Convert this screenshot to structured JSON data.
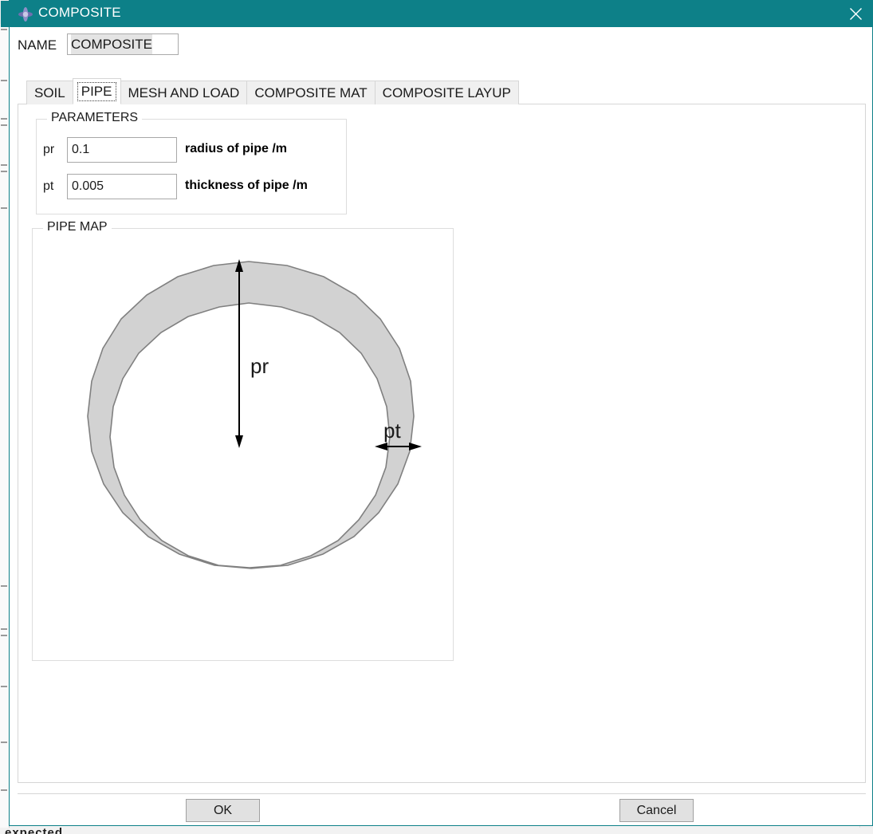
{
  "window": {
    "title": "COMPOSITE",
    "app_icon": "plus-crosshair-icon",
    "close_icon": "close-icon",
    "titlebar_color": "#0d8088"
  },
  "name_field": {
    "label": "NAME",
    "value": "COMPOSITE",
    "placeholder": "COMPOSITE"
  },
  "tabs": [
    {
      "label": "SOIL",
      "active": false
    },
    {
      "label": "PIPE",
      "active": true
    },
    {
      "label": "MESH AND LOAD",
      "active": false
    },
    {
      "label": "COMPOSITE MAT",
      "active": false
    },
    {
      "label": "COMPOSITE LAYUP",
      "active": false
    }
  ],
  "parameters_group": {
    "title": "PARAMETERS",
    "rows": [
      {
        "name": "pr",
        "value": "0.1",
        "description": "radius of pipe /m"
      },
      {
        "name": "pt",
        "value": "0.005",
        "description": "thickness of pipe /m"
      }
    ]
  },
  "pipe_map_group": {
    "title": "PIPE MAP",
    "diagram": {
      "type": "annulus-cross-section",
      "fill_color": "#d2d2d2",
      "stroke_color": "#808080",
      "radius_label": "pr",
      "thickness_label": "pt"
    }
  },
  "footer": {
    "ok_label": "OK",
    "cancel_label": "Cancel"
  },
  "background": {
    "cut_off_text": "expected"
  }
}
